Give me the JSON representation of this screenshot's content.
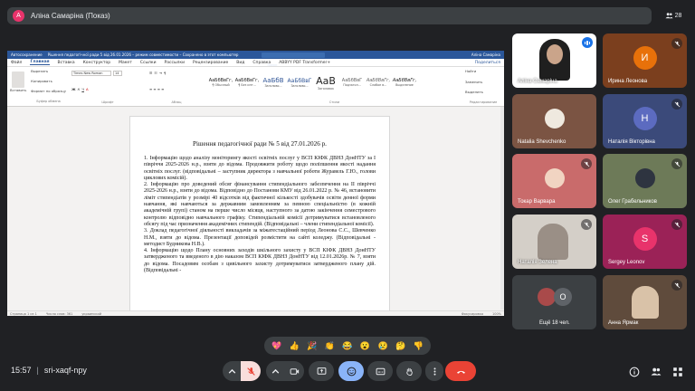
{
  "presenter": {
    "initial": "A",
    "name": "Аліна Самаріна (Показ)"
  },
  "participants_count": "28",
  "word": {
    "titlebar": [
      "Автосохранение",
      "Рішення педагогічної ради 5 від 26.01.2026 – режим совместимости – Сохранено в этот компьютер",
      "Аліна Самаріна"
    ],
    "search_placeholder": "Поиск",
    "menus": [
      "Файл",
      "Главная",
      "Вставка",
      "Конструктор",
      "Макет",
      "Ссылки",
      "Рассылки",
      "Рецензирование",
      "Вид",
      "Справка",
      "ABBYY PDF Transformer+"
    ],
    "share_label": "Поделиться",
    "clipboard": {
      "cut": "Вырезать",
      "copy": "Копировать",
      "format": "Формат по образцу",
      "paste": "Вставить",
      "group": "Буфер обмена"
    },
    "font": {
      "name": "Times New Roman",
      "size": "14",
      "group": "Шрифт"
    },
    "paragraph_group": "Абзац",
    "styles": [
      {
        "sample": "АаБбВвГг,",
        "label": "¶ Обычный"
      },
      {
        "sample": "АаБбВвГг,",
        "label": "¶ Без инт..."
      },
      {
        "sample": "АаБбВ",
        "label": "Заголово..."
      },
      {
        "sample": "АаБбВвГ",
        "label": "Заголово..."
      },
      {
        "sample": "АаВ",
        "label": "Заголовок"
      },
      {
        "sample": "АаБбВвГ",
        "label": "Подзагол..."
      },
      {
        "sample": "АаБбВвГг,",
        "label": "Слабое в..."
      },
      {
        "sample": "АаБбВвГг,",
        "label": "Выделение"
      }
    ],
    "styles_group": "Стили",
    "editing": {
      "find": "Найти",
      "replace": "Заменить",
      "select": "Выделить",
      "group": "Редактирование"
    },
    "doc_title": "Рішення педагогічної ради № 5 від 27.01.2026 р.",
    "paragraphs": [
      "1. Інформацію щодо аналізу моніторингу якості освітніх послуг у ВСП КІФК ДВНЗ ДонНТУ за I півріччя 2025-2026 н.р., взяти до відома. Продовжити роботу щодо поліпшення якості надання освітніх послуг. (відповідальні – заступник директора з навчальної роботи Журавель Г.Ю., голови циклових комісій).",
      "2. Інформацію про доведений обсяг фінансування стипендіального забезпечення на II півріччі 2025-2026 н.р., взяти до відома. Відповідно до Постанови КМУ від 26.01.2022 р. № 46, встановити ліміт стипендіатів у розмірі 40 відсотків від фактичної кількості здобувачів освіти денної форми навчання, які навчаються за державним замовленням за певною спеціальністю (в кожній академічній групі) станом на перше число місяця, наступного за датою закінчення семестрового контролю відповідно навчального графіку. Стипендіальній комісії дотримуватися встановленого обсягу під час призначення академічних стипендій. (Відповідальні – члени стипендіальної комісії).",
      "3. Доклад педагогічної діяльності викладачів за міжатестаційний період Леонова С.С., Шевченко Н.М., взяти до відома. Презентації доповідей розмістити на сайті коледжу. (Відповідальні - методист Будникова Н.В.).",
      "4. Інформацію щодо Плану основних заходів шкільного захисту у ВСП КІФК ДВНЗ ДонНТУ затвердженого та введеного в дію наказом ВСП КІФК ДВНЗ ДонНТУ від 12.01.2026р. № 7, взяти до відома. Посадовим особам з цивільного захисту дотримуватися затвердженого плану дій. (Відповідальні -"
    ],
    "status_left": "Страница 1 из 1",
    "status_words": "Число слов: 361",
    "status_lang": "украинский",
    "status_focus": "Фокусировка",
    "zoom": "100%"
  },
  "tiles": [
    {
      "name": "Аліна Самаріна",
      "type": "photo",
      "bg": "#ffffff",
      "speaking": true
    },
    {
      "name": "Ирина Леонова",
      "type": "letter",
      "letter": "И",
      "bg": "#7b3f1e",
      "circle": "#e8710a",
      "muted": true
    },
    {
      "name": "Natalia Shevchenko",
      "type": "photo",
      "bg": "#7b5443",
      "muted": false
    },
    {
      "name": "Наталія Вікторівна",
      "type": "letter",
      "letter": "Н",
      "bg": "#3b4a7a",
      "circle": "#5c6bc0",
      "muted": true
    },
    {
      "name": "Токар Варвара",
      "type": "photo",
      "bg": "#c96b6b",
      "muted": true
    },
    {
      "name": "Олег Грабельников",
      "type": "photo",
      "bg": "#6d7a58",
      "muted": true
    },
    {
      "name": "Наталія Зелена",
      "type": "photo",
      "bg": "#d4cfc8",
      "muted": true
    },
    {
      "name": "Sergey Leonov",
      "type": "letter",
      "letter": "S",
      "bg": "#9b2257",
      "circle": "#e8336b",
      "muted": true
    },
    {
      "name": "Ещё 18 чел.",
      "type": "more",
      "bg": "#3c4043",
      "letter": "О"
    },
    {
      "name": "Анна Ярмак",
      "type": "photo",
      "bg": "#5f4b3c",
      "muted": true
    }
  ],
  "reactions": [
    "💖",
    "👍",
    "🎉",
    "👏",
    "😂",
    "😮",
    "😢",
    "🤔",
    "👎"
  ],
  "clock": {
    "time": "15:57",
    "meeting_code": "sri-xaqf-npy"
  }
}
